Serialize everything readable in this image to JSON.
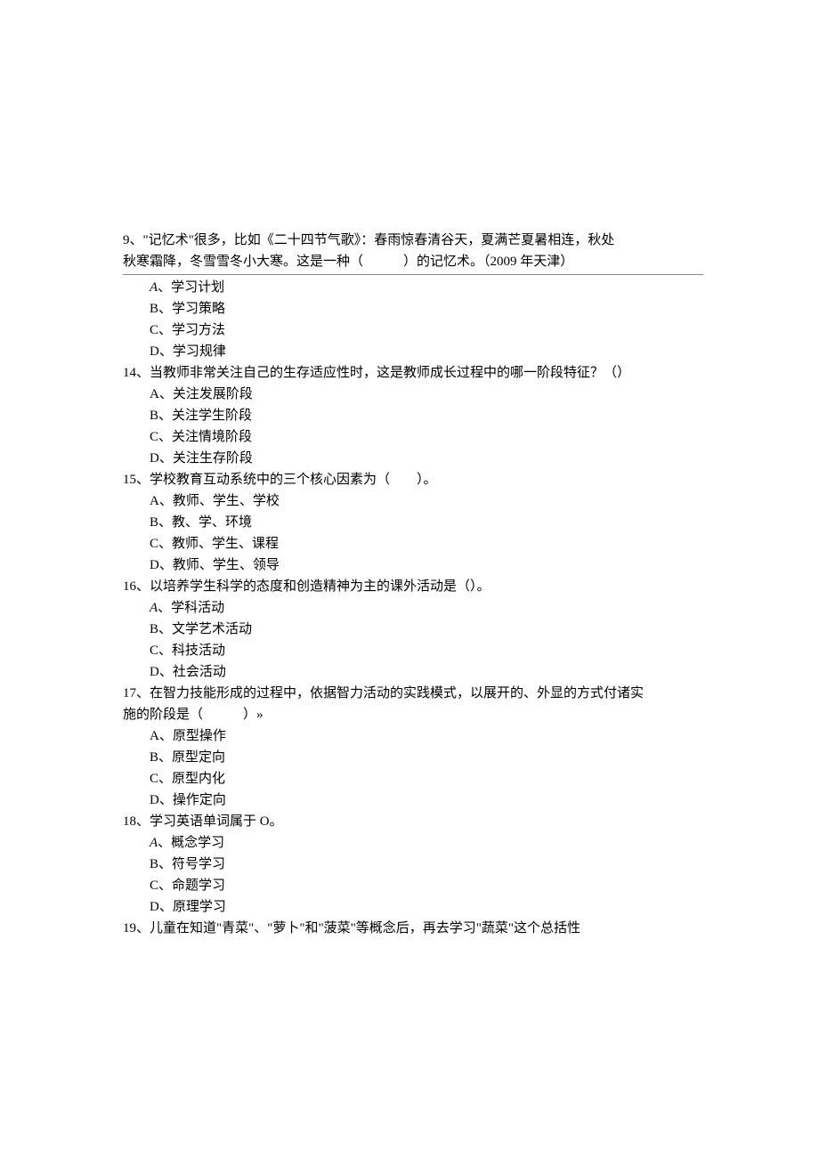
{
  "q9": {
    "stem_line1": "9、\"记忆术\"很多，比如《二十四节气歌》：春雨惊春清谷天，夏满芒夏暑相连，秋处",
    "stem_line2_before": "秋寒霜降，冬雪雪冬小大寒。这是一种（",
    "stem_line2_after": "）的记忆术。（2009 年天津）"
  },
  "q13": {
    "optA_letter": "A",
    "optA_text": "、学习计划",
    "optB": "B、学习策略",
    "optC": "C、学习方法",
    "optD": "D、学习规律"
  },
  "q14": {
    "stem": "14、当教师非常关注自己的生存适应性时，这是教师成长过程中的哪一阶段特征？（）",
    "optA": "A、关注发展阶段",
    "optB": "B、关注学生阶段",
    "optC": "C、关注情境阶段",
    "optD": "D、关注生存阶段"
  },
  "q15": {
    "stem_before": "15、学校教育互动系统中的三个核心因素为（",
    "stem_after": "）。",
    "optA": "A、教师、学生、学校",
    "optB": "B、教、学、环境",
    "optC": "C、教师、学生、课程",
    "optD": "D、教师、学生、领导"
  },
  "q16": {
    "stem": "16、以培养学生科学的态度和创造精神为主的课外活动是（）。",
    "optA_letter": "A",
    "optA_text": "、学科活动",
    "optB": "B、文学艺术活动",
    "optC": "C、科技活动",
    "optD": "D、社会活动"
  },
  "q17": {
    "stem_line1": "17、在智力技能形成的过程中，依据智力活动的实践模式，以展开的、外显的方式付诸实",
    "stem_line2_before": "施的阶段是（",
    "stem_line2_after": "）»",
    "optA": "A、原型操作",
    "optB": "B、原型定向",
    "optC": "C、原型内化",
    "optD": "D、操作定向"
  },
  "q18": {
    "stem": "18、学习英语单词属于 O。",
    "optA_letter": "A",
    "optA_text": "、概念学习",
    "optB": "B、符号学习",
    "optC": "C、命题学习",
    "optD": "D、原理学习"
  },
  "q19": {
    "stem": "19、儿童在知道\"青菜\"、\"萝卜\"和\"菠菜\"等概念后，再去学习\"蔬菜\"这个总括性"
  }
}
